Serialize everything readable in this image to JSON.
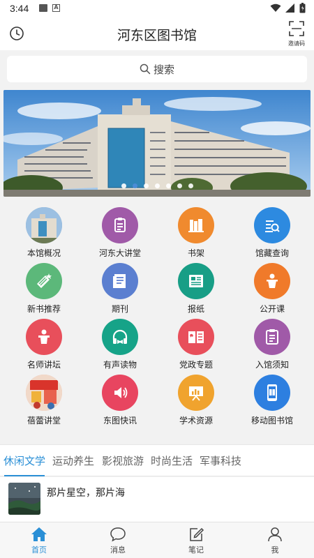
{
  "status_bar": {
    "time": "3:44",
    "ic2_text": "A"
  },
  "header": {
    "title": "河东区图书馆",
    "qr_label": "邀请码"
  },
  "search": {
    "placeholder": "搜索"
  },
  "banner": {
    "dot_count": 7,
    "active_index": 1
  },
  "grid": {
    "items": [
      {
        "label": "本馆概况",
        "icon": "library-building-photo",
        "color": "#8aa6c2"
      },
      {
        "label": "河东大讲堂",
        "icon": "clipboard-icon",
        "color": "#a05aa8"
      },
      {
        "label": "书架",
        "icon": "bookshelf-icon",
        "color": "#f08a2e"
      },
      {
        "label": "馆藏查询",
        "icon": "search-document-icon",
        "color": "#2d8ae0"
      },
      {
        "label": "新书推荐",
        "icon": "new-books-icon",
        "color": "#5cb87a"
      },
      {
        "label": "期刊",
        "icon": "journal-icon",
        "color": "#5b7fd0"
      },
      {
        "label": "报纸",
        "icon": "newspaper-icon",
        "color": "#189e86"
      },
      {
        "label": "公开课",
        "icon": "lecturer-icon",
        "color": "#f07a2a"
      },
      {
        "label": "名师讲坛",
        "icon": "podium-icon",
        "color": "#e84f5b"
      },
      {
        "label": "有声读物",
        "icon": "headphones-icon",
        "color": "#16a388"
      },
      {
        "label": "党政专题",
        "icon": "party-book-icon",
        "color": "#e84f5b"
      },
      {
        "label": "入馆须知",
        "icon": "notice-icon",
        "color": "#a05aa8"
      },
      {
        "label": "蓓蕾讲堂",
        "icon": "kids-lecture-photo",
        "color": "#e9b3a8"
      },
      {
        "label": "东图快讯",
        "icon": "speaker-icon",
        "color": "#e84560"
      },
      {
        "label": "学术资源",
        "icon": "presentation-icon",
        "color": "#f0a32e"
      },
      {
        "label": "移动图书馆",
        "icon": "mobile-book-icon",
        "color": "#2d7fe0"
      }
    ]
  },
  "tabs": [
    {
      "label": "休闲文学",
      "active": true
    },
    {
      "label": "运动养生",
      "active": false
    },
    {
      "label": "影视旅游",
      "active": false
    },
    {
      "label": "时尚生活",
      "active": false
    },
    {
      "label": "军事科技",
      "active": false
    }
  ],
  "article": {
    "title": "那片星空，那片海"
  },
  "bottom_nav": [
    {
      "label": "首页",
      "icon": "home-icon",
      "active": true
    },
    {
      "label": "消息",
      "icon": "message-icon",
      "active": false
    },
    {
      "label": "笔记",
      "icon": "note-icon",
      "active": false
    },
    {
      "label": "我",
      "icon": "user-icon",
      "active": false
    }
  ],
  "accent_color": "#2a8fd6"
}
